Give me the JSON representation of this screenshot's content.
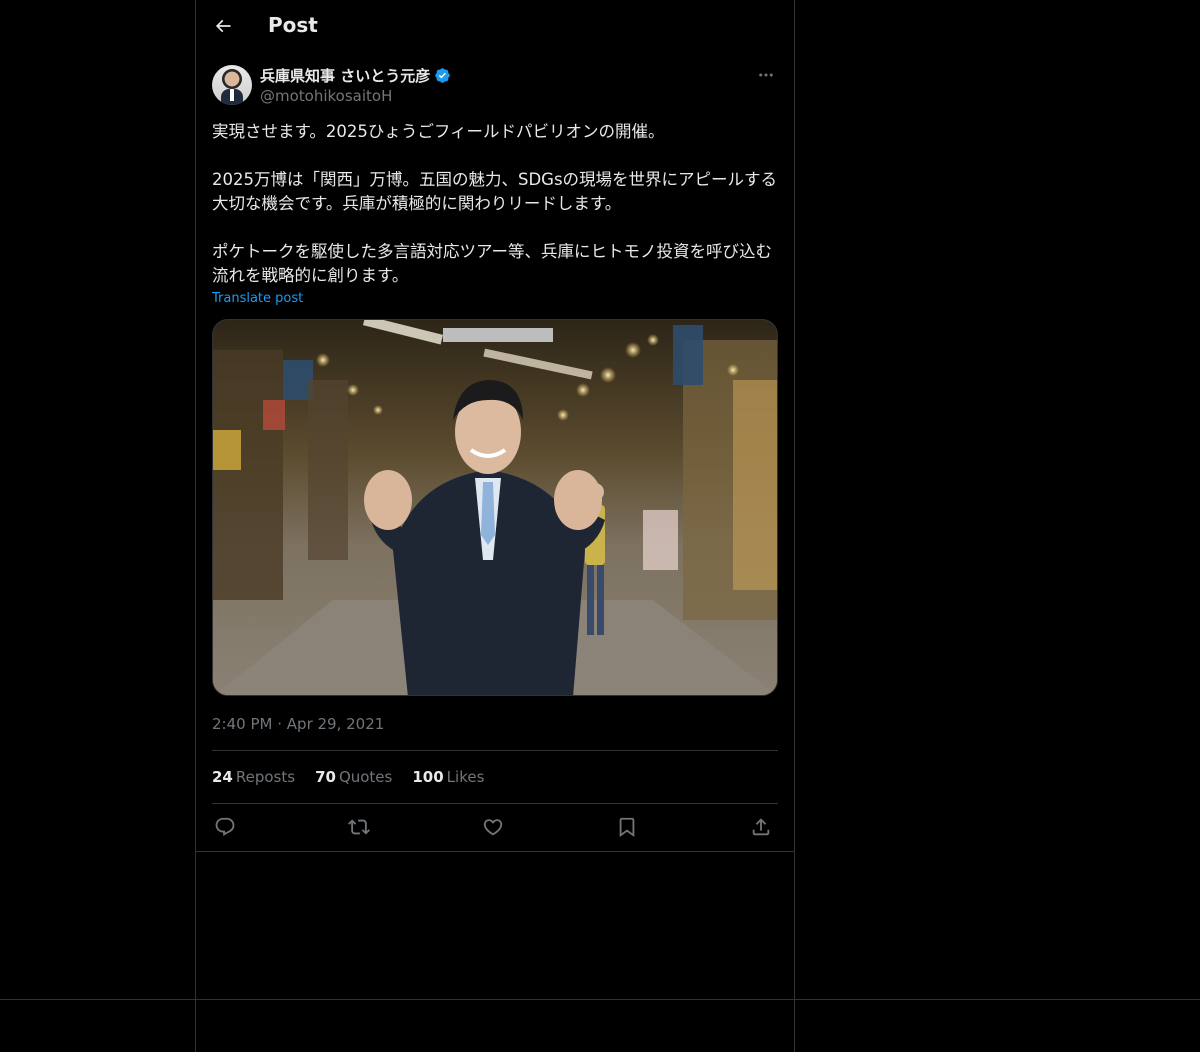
{
  "header": {
    "title": "Post"
  },
  "author": {
    "name": "兵庫県知事 さいとう元彦",
    "handle": "@motohikosaitoH",
    "verified": true
  },
  "post": {
    "paragraphs": [
      "実現させます。2025ひょうごフィールドパビリオンの開催。",
      "2025万博は「関西」万博。五国の魅力、SDGsの現場を世界にアピールする大切な機会です。兵庫が積極的に関わりリードします。",
      "ポケトークを駆使した多言語対応ツアー等、兵庫にヒトモノ投資を呼び込む流れを戦略的に創ります。"
    ],
    "translate_label": "Translate post",
    "time": "2:40 PM",
    "separator": "·",
    "date": "Apr 29, 2021"
  },
  "stats": {
    "reposts_count": "24",
    "reposts_label": "Reposts",
    "quotes_count": "70",
    "quotes_label": "Quotes",
    "likes_count": "100",
    "likes_label": "Likes"
  },
  "icons": {
    "back": "arrow-left-icon",
    "more": "more-horizontal-icon",
    "reply": "reply-icon",
    "repost": "repost-icon",
    "like": "heart-icon",
    "bookmark": "bookmark-icon",
    "share": "share-icon"
  },
  "colors": {
    "background": "#000000",
    "text": "#e7e9ea",
    "muted": "#71767b",
    "accent": "#1d9bf0",
    "border": "#2f3336"
  }
}
